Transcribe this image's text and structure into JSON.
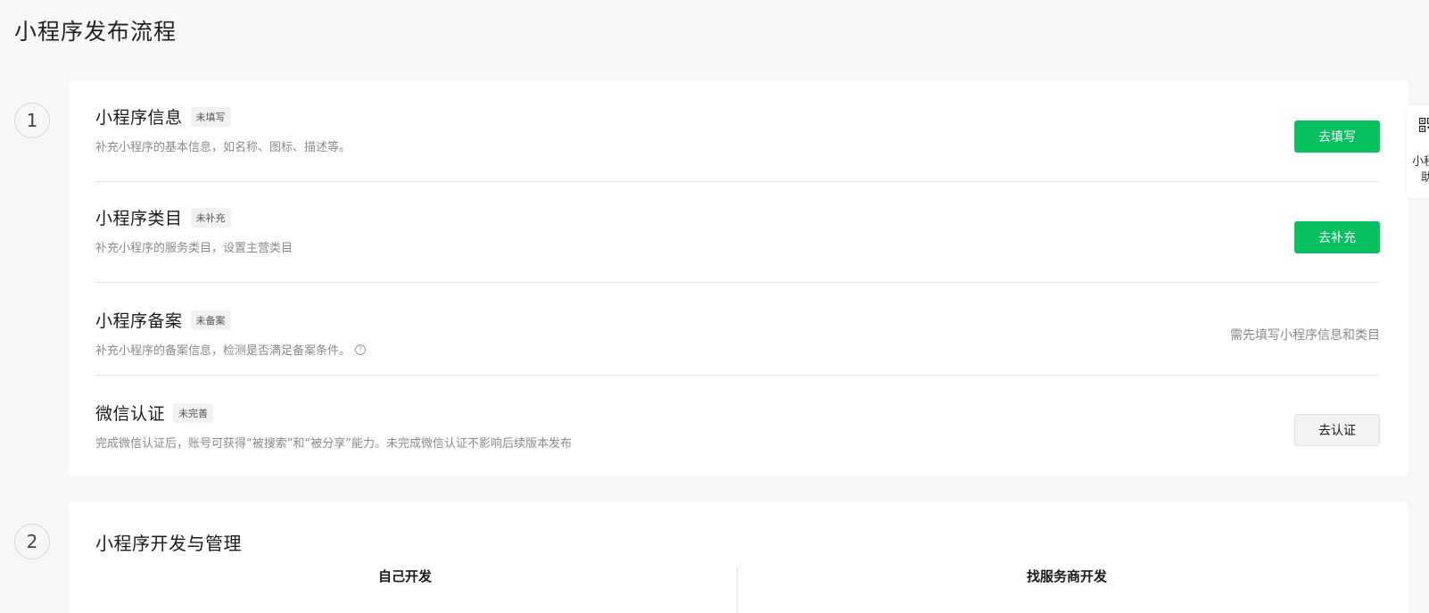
{
  "page": {
    "title": "小程序发布流程"
  },
  "steps": [
    {
      "number": "1"
    },
    {
      "number": "2"
    }
  ],
  "step1": {
    "rows": [
      {
        "title": "小程序信息",
        "badge": "未填写",
        "desc": "补充小程序的基本信息，如名称、图标、描述等。",
        "action": "去填写"
      },
      {
        "title": "小程序类目",
        "badge": "未补充",
        "desc": "补充小程序的服务类目，设置主营类目",
        "action": "去补充"
      },
      {
        "title": "小程序备案",
        "badge": "未备案",
        "desc": "补充小程序的备案信息，检测是否满足备案条件。",
        "help_glyph": "?",
        "note": "需先填写小程序信息和类目"
      },
      {
        "title": "微信认证",
        "badge": "未完善",
        "desc": "完成微信认证后，账号可获得“被搜索”和“被分享”能力。未完成微信认证不影响后续版本发布",
        "action": "去认证"
      }
    ]
  },
  "step2": {
    "title": "小程序开发与管理",
    "tabs": [
      "自己开发",
      "找服务商开发"
    ]
  },
  "side_helper": {
    "line1": "小程",
    "line2": "助"
  },
  "colors": {
    "primary": "#07c160",
    "background": "#f6f7f9",
    "card": "#ffffff",
    "muted_text": "#8a8a8a"
  },
  "icons": {
    "help": "question-circle-icon",
    "qr": "qrcode-icon"
  }
}
